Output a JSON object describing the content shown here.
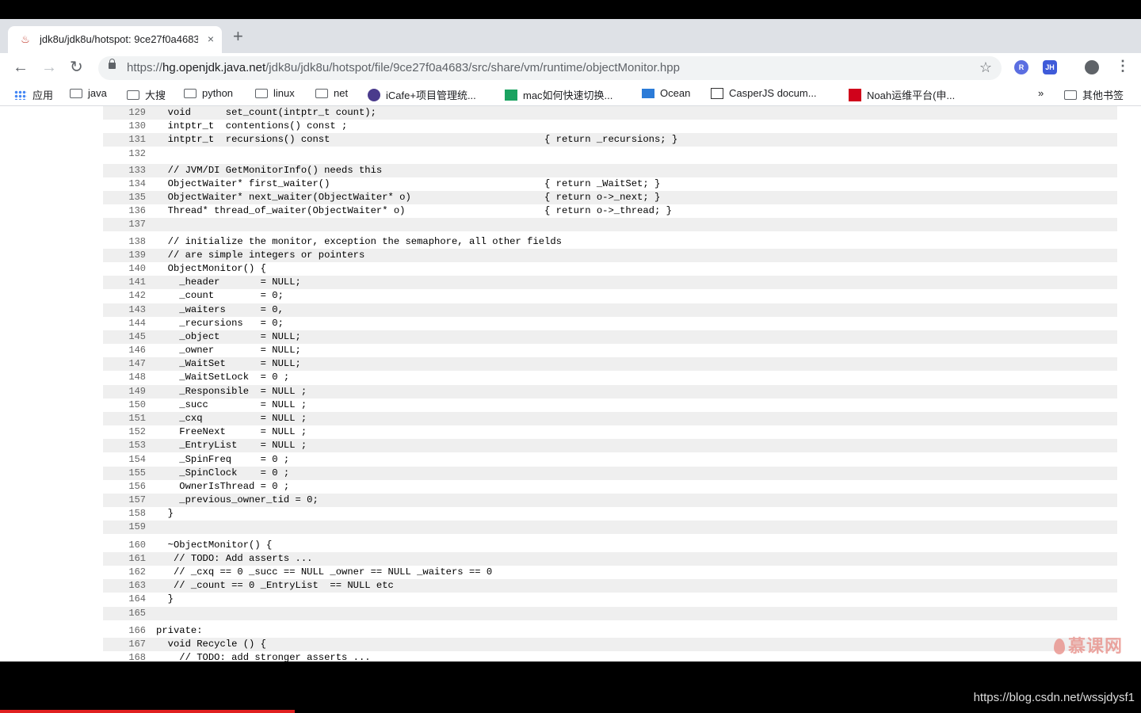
{
  "tab": {
    "title": "jdk8u/jdk8u/hotspot: 9ce27f0a4683",
    "close": "×",
    "new_tab": "+"
  },
  "toolbar": {
    "back": "←",
    "forward": "→",
    "reload": "↻",
    "url_scheme": "https://",
    "url_host": "hg.openjdk.java.net",
    "url_path": "/jdk8u/jdk8u/hotspot/file/9ce27f0a4683/src/share/vm/runtime/objectMonitor.hpp",
    "star": "☆",
    "ext_r": "R",
    "ext_jh": "JH",
    "menu": "⋮"
  },
  "bookmarks": {
    "apps": "应用",
    "items": [
      "java",
      "大搜",
      "python",
      "linux",
      "net",
      "iCafe+项目管理统...",
      "mac如何快速切换...",
      "Ocean",
      "CasperJS docum...",
      "Noah运维平台(申..."
    ],
    "overflow": "»",
    "other": "其他书签"
  },
  "code_lines": [
    {
      "n": "129",
      "t": "  void      set_count(intptr_t count);"
    },
    {
      "n": "130",
      "t": "  intptr_t  contentions() const ;"
    },
    {
      "n": "131",
      "t": "  intptr_t  recursions() const                                     { return _recursions; }"
    },
    {
      "n": "132",
      "t": ""
    },
    {
      "n": "133",
      "t": "  // JVM/DI GetMonitorInfo() needs this"
    },
    {
      "n": "134",
      "t": "  ObjectWaiter* first_waiter()                                     { return _WaitSet; }"
    },
    {
      "n": "135",
      "t": "  ObjectWaiter* next_waiter(ObjectWaiter* o)                       { return o->_next; }"
    },
    {
      "n": "136",
      "t": "  Thread* thread_of_waiter(ObjectWaiter* o)                        { return o->_thread; }"
    },
    {
      "n": "137",
      "t": ""
    },
    {
      "n": "138",
      "t": "  // initialize the monitor, exception the semaphore, all other fields"
    },
    {
      "n": "139",
      "t": "  // are simple integers or pointers"
    },
    {
      "n": "140",
      "t": "  ObjectMonitor() {"
    },
    {
      "n": "141",
      "t": "    _header       = NULL;"
    },
    {
      "n": "142",
      "t": "    _count        = 0;"
    },
    {
      "n": "143",
      "t": "    _waiters      = 0,"
    },
    {
      "n": "144",
      "t": "    _recursions   = 0;"
    },
    {
      "n": "145",
      "t": "    _object       = NULL;"
    },
    {
      "n": "146",
      "t": "    _owner        = NULL;"
    },
    {
      "n": "147",
      "t": "    _WaitSet      = NULL;"
    },
    {
      "n": "148",
      "t": "    _WaitSetLock  = 0 ;"
    },
    {
      "n": "149",
      "t": "    _Responsible  = NULL ;"
    },
    {
      "n": "150",
      "t": "    _succ         = NULL ;"
    },
    {
      "n": "151",
      "t": "    _cxq          = NULL ;"
    },
    {
      "n": "152",
      "t": "    FreeNext      = NULL ;"
    },
    {
      "n": "153",
      "t": "    _EntryList    = NULL ;"
    },
    {
      "n": "154",
      "t": "    _SpinFreq     = 0 ;"
    },
    {
      "n": "155",
      "t": "    _SpinClock    = 0 ;"
    },
    {
      "n": "156",
      "t": "    OwnerIsThread = 0 ;"
    },
    {
      "n": "157",
      "t": "    _previous_owner_tid = 0;"
    },
    {
      "n": "158",
      "t": "  }"
    },
    {
      "n": "159",
      "t": ""
    },
    {
      "n": "160",
      "t": "  ~ObjectMonitor() {"
    },
    {
      "n": "161",
      "t": "   // TODO: Add asserts ..."
    },
    {
      "n": "162",
      "t": "   // _cxq == 0 _succ == NULL _owner == NULL _waiters == 0"
    },
    {
      "n": "163",
      "t": "   // _count == 0 _EntryList  == NULL etc"
    },
    {
      "n": "164",
      "t": "  }"
    },
    {
      "n": "165",
      "t": ""
    },
    {
      "n": "166",
      "t": "private:"
    },
    {
      "n": "167",
      "t": "  void Recycle () {"
    },
    {
      "n": "168",
      "t": "    // TODO: add stronger asserts ..."
    }
  ],
  "watermark": "慕课网",
  "credit": "https://blog.csdn.net/wssjdysf1"
}
